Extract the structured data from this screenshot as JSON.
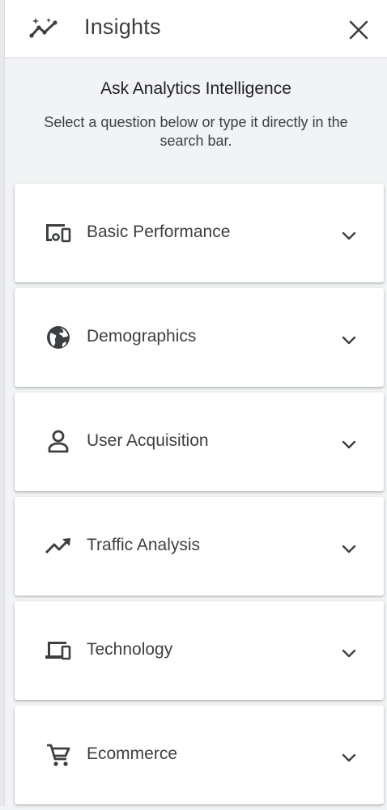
{
  "header": {
    "title": "Insights",
    "icon": "insights-sparkle-icon",
    "close_icon": "close-icon"
  },
  "intro": {
    "heading": "Ask Analytics Intelligence",
    "text": "Select a question below or type it directly in the search bar."
  },
  "categories": [
    {
      "label": "Basic Performance",
      "icon": "devices-dashboard-icon"
    },
    {
      "label": "Demographics",
      "icon": "globe-icon"
    },
    {
      "label": "User Acquisition",
      "icon": "person-icon"
    },
    {
      "label": "Traffic Analysis",
      "icon": "trending-up-icon"
    },
    {
      "label": "Technology",
      "icon": "devices-icon"
    },
    {
      "label": "Ecommerce",
      "icon": "shopping-cart-icon"
    }
  ],
  "colors": {
    "panel_bg": "#f1f3f4",
    "card_bg": "#ffffff",
    "text": "#3c4043",
    "icon": "#3c4043"
  }
}
